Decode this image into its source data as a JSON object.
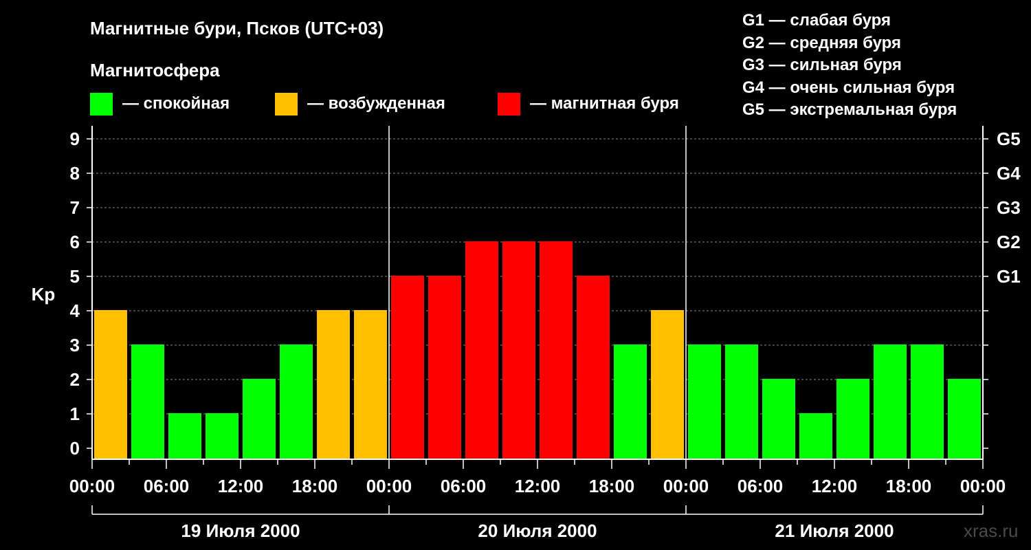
{
  "header": {
    "title": "Магнитные бури, Псков (UTC+03)",
    "subtitle": "Магнитосфера"
  },
  "legend": [
    {
      "label": "— спокойная",
      "color": "#00ff00"
    },
    {
      "label": "— возбужденная",
      "color": "#ffc000"
    },
    {
      "label": "— магнитная буря",
      "color": "#ff0000"
    }
  ],
  "storm_levels": [
    "G1 — слабая буря",
    "G2 — средняя буря",
    "G3 — сильная буря",
    "G4 — очень сильная буря",
    "G5 — экстремальная буря"
  ],
  "watermark": "xras.ru",
  "chart_data": {
    "type": "bar",
    "ylabel": "Kp",
    "ylim": [
      0,
      9
    ],
    "yticks": [
      0,
      1,
      2,
      3,
      4,
      5,
      6,
      7,
      8,
      9
    ],
    "right_ticks": [
      {
        "value": 5,
        "label": "G1"
      },
      {
        "value": 6,
        "label": "G2"
      },
      {
        "value": 7,
        "label": "G3"
      },
      {
        "value": 8,
        "label": "G4"
      },
      {
        "value": 9,
        "label": "G5"
      }
    ],
    "grid": true,
    "xtick_labels": [
      "00:00",
      "06:00",
      "12:00",
      "18:00",
      "00:00",
      "06:00",
      "12:00",
      "18:00",
      "00:00",
      "06:00",
      "12:00",
      "18:00",
      "00:00"
    ],
    "days": [
      "19 Июля 2000",
      "20 Июля 2000",
      "21 Июля 2000"
    ],
    "interval_hours": 3,
    "colors": {
      "quiet": "#00ff00",
      "active": "#ffc000",
      "storm": "#ff0000"
    },
    "values": [
      4,
      3,
      1,
      1,
      2,
      3,
      4,
      4,
      5,
      5,
      6,
      6,
      6,
      5,
      3,
      4,
      3,
      3,
      2,
      1,
      2,
      3,
      3,
      2
    ]
  }
}
